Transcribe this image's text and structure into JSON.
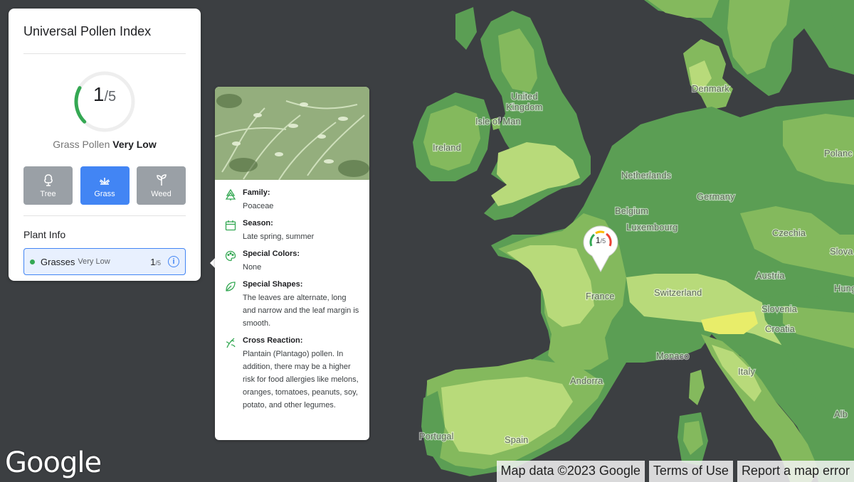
{
  "panel": {
    "title": "Universal Pollen Index",
    "gauge": {
      "value": "1",
      "max": "/5",
      "fraction": 0.2
    },
    "status_type": "Grass Pollen",
    "status_level": "Very Low",
    "types": [
      {
        "label": "Tree",
        "icon": "tree-icon",
        "active": false
      },
      {
        "label": "Grass",
        "icon": "grass-icon",
        "active": true
      },
      {
        "label": "Weed",
        "icon": "weed-icon",
        "active": false
      }
    ],
    "plant_info_title": "Plant Info",
    "plant": {
      "name": "Grasses",
      "level": "Very Low",
      "score": "1",
      "max": "/5",
      "info_icon": "info-icon"
    }
  },
  "card": {
    "facts": [
      {
        "icon": "tree-family-icon",
        "label": "Family:",
        "value": "Poaceae"
      },
      {
        "icon": "calendar-icon",
        "label": "Season:",
        "value": "Late spring, summer"
      },
      {
        "icon": "palette-icon",
        "label": "Special Colors:",
        "value": "None"
      },
      {
        "icon": "leaf-icon",
        "label": "Special Shapes:",
        "value": "The leaves are alternate, long and narrow and the leaf margin is smooth."
      },
      {
        "icon": "cross-reaction-icon",
        "label": "Cross Reaction:",
        "value": "Plantain (Plantago) pollen. In addition, there may be a higher risk for food allergies like melons, oranges, tomatoes, peanuts, soy, potato, and other legumes."
      }
    ]
  },
  "marker": {
    "value": "1",
    "max": "/5"
  },
  "map_labels": {
    "uk": "United Kingdom",
    "uk1": "United",
    "uk2": "Kingdom",
    "isle_of_man": "Isle of Man",
    "ireland": "Ireland",
    "netherlands": "Netherlands",
    "belgium": "Belgium",
    "luxembourg": "Luxembourg",
    "germany": "Germany",
    "denmark": "Denmark",
    "poland": "Polanc",
    "czechia": "Czechia",
    "slovakia": "Slova",
    "austria": "Austria",
    "hungary": "Hung",
    "switzerland": "Switzerland",
    "slovenia": "Slovenia",
    "croatia": "Croatia",
    "france": "France",
    "monaco": "Monaco",
    "andorra": "Andorra",
    "italy": "Italy",
    "portugal": "Portugal",
    "spain": "Spain",
    "albania": "Alb"
  },
  "footer": {
    "logo": "Google",
    "map_data": "Map data ©2023 Google",
    "terms": "Terms of Use",
    "report": "Report a map error"
  },
  "colors": {
    "sea": "#3c3f42",
    "land_dark": "#5b9e54",
    "land_mid": "#84b95d",
    "land_light": "#b8da7a",
    "accent_yellow": "#e8ed6a",
    "accent_blue": "#4285f4",
    "gauge_green": "#34a853"
  }
}
